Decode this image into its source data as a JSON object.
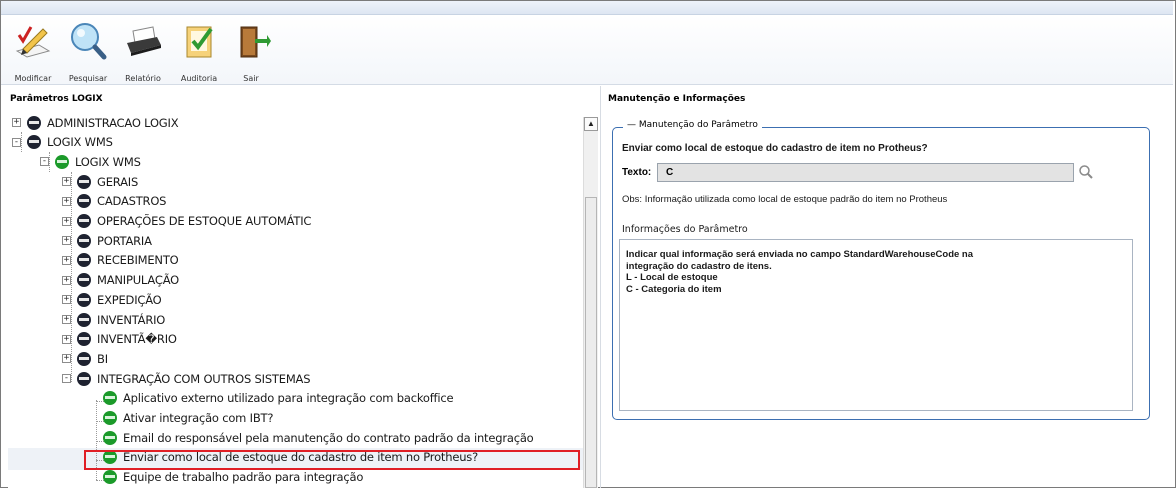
{
  "toolbar": {
    "buttons": [
      {
        "id": "modificar",
        "label": "Modificar",
        "icon": "pencil-edit-icon"
      },
      {
        "id": "pesquisar",
        "label": "Pesquisar",
        "icon": "magnifier-icon"
      },
      {
        "id": "relatorio",
        "label": "Relatório",
        "icon": "printer-icon"
      },
      {
        "id": "auditoria",
        "label": "Auditoria",
        "icon": "checklist-icon"
      },
      {
        "id": "sair",
        "label": "Sair",
        "icon": "exit-door-icon"
      }
    ]
  },
  "left_panel": {
    "title": "Parâmetros LOGIX",
    "tree": [
      {
        "label": "ADMINISTRACAO LOGIX",
        "level": 0,
        "toggle": "+",
        "node": "dark"
      },
      {
        "label": "LOGIX WMS",
        "level": 0,
        "toggle": "-",
        "node": "dark"
      },
      {
        "label": "LOGIX WMS",
        "level": 1,
        "toggle": "-",
        "node": "green"
      },
      {
        "label": "GERAIS",
        "level": 2,
        "toggle": "+",
        "node": "dark"
      },
      {
        "label": "CADASTROS",
        "level": 2,
        "toggle": "+",
        "node": "dark"
      },
      {
        "label": "OPERAÇÕES DE ESTOQUE AUTOMÁTIC",
        "level": 2,
        "toggle": "+",
        "node": "dark"
      },
      {
        "label": "PORTARIA",
        "level": 2,
        "toggle": "+",
        "node": "dark"
      },
      {
        "label": "RECEBIMENTO",
        "level": 2,
        "toggle": "+",
        "node": "dark"
      },
      {
        "label": "MANIPULAÇÃO",
        "level": 2,
        "toggle": "+",
        "node": "dark"
      },
      {
        "label": "EXPEDIÇÃO",
        "level": 2,
        "toggle": "+",
        "node": "dark"
      },
      {
        "label": "INVENTÁRIO",
        "level": 2,
        "toggle": "+",
        "node": "dark"
      },
      {
        "label": "INVENTÃ�RIO",
        "level": 2,
        "toggle": "+",
        "node": "dark"
      },
      {
        "label": "BI",
        "level": 2,
        "toggle": "+",
        "node": "dark"
      },
      {
        "label": "INTEGRAÇÃO COM OUTROS SISTEMAS",
        "level": 2,
        "toggle": "-",
        "node": "dark"
      },
      {
        "label": "Aplicativo externo utilizado para integração com backoffice",
        "level": 3,
        "toggle": "",
        "node": "green"
      },
      {
        "label": "Ativar integração com IBT?",
        "level": 3,
        "toggle": "",
        "node": "green"
      },
      {
        "label": "Email do responsável pela manutenção do contrato padrão da integração",
        "level": 3,
        "toggle": "",
        "node": "green"
      },
      {
        "label": "Enviar como local de estoque do cadastro de item no Protheus?",
        "level": 3,
        "toggle": "",
        "node": "green",
        "selected": true
      },
      {
        "label": "Equipe de trabalho padrão para integração",
        "level": 3,
        "toggle": "",
        "node": "green"
      }
    ]
  },
  "right_panel": {
    "title": "Manutenção e Informações",
    "fieldset_legend": "Manutenção do Parâmetro",
    "question": "Enviar como local de estoque do cadastro de item no Protheus?",
    "texto_label": "Texto:",
    "texto_value": "C",
    "obs": "Obs: Informação utilizada como local de estoque padrão do item no Protheus",
    "info_title": "Informações do Parâmetro",
    "info_lines": [
      "Indicar qual informação será enviada no campo StandardWarehouseCode na",
      "integração do cadastro de itens.",
      "L - Local de estoque",
      "C - Categoria do item"
    ]
  },
  "colors": {
    "highlight_border": "#e01f26",
    "fieldset_border": "#3c6fb1",
    "node_dark": "#1e2230",
    "node_green": "#1b9a2a"
  }
}
